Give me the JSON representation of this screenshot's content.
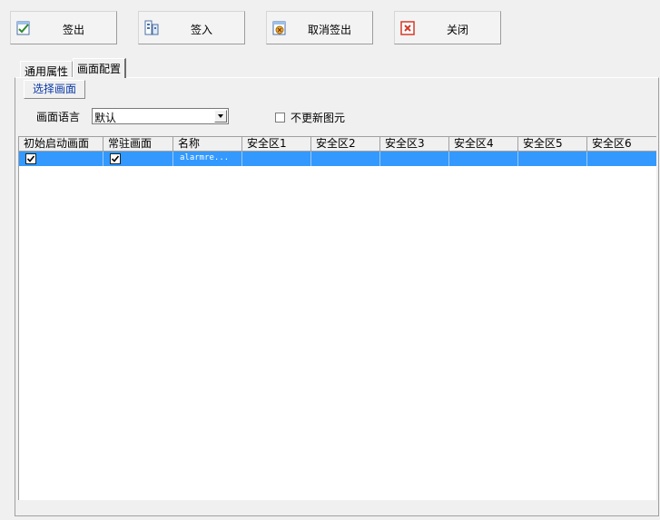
{
  "toolbar": {
    "checkout_label": "签出",
    "checkin_label": "签入",
    "cancel_checkout_label": "取消签出",
    "close_label": "关闭",
    "checkout_icon": "checkout-icon",
    "checkin_icon": "checkin-icon",
    "cancel_checkout_icon": "cancel-checkout-icon",
    "close_icon": "close-icon"
  },
  "tabs": [
    {
      "label": "通用属性",
      "active": false
    },
    {
      "label": "画面配置",
      "active": true
    }
  ],
  "select_screen_button": "选择画面",
  "language": {
    "label": "画面语言",
    "value": "默认"
  },
  "no_update_elements": {
    "label": "不更新图元",
    "checked": false
  },
  "grid": {
    "columns": [
      "初始启动画面",
      "常驻画面",
      "名称",
      "安全区1",
      "安全区2",
      "安全区3",
      "安全区4",
      "安全区5",
      "安全区6"
    ],
    "rows": [
      {
        "initial_start": true,
        "resident": true,
        "name": "alarmre...",
        "zones": [
          "",
          "",
          "",
          "",
          "",
          ""
        ],
        "selected": true
      }
    ]
  },
  "colors": {
    "selection": "#3399ff",
    "link_text": "#0c3aa8",
    "background": "#f0f0f0"
  }
}
